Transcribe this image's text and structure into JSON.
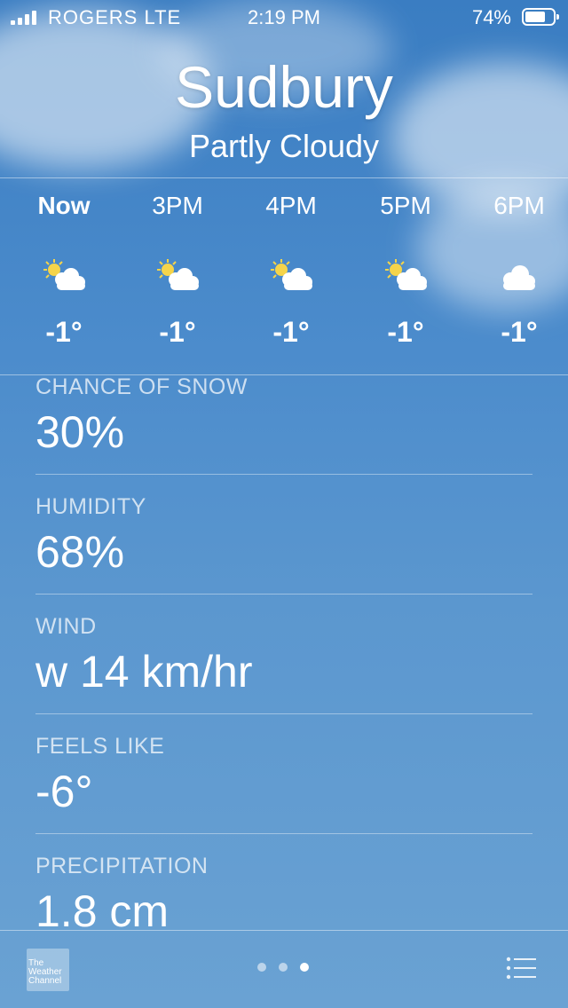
{
  "status_bar": {
    "carrier": "ROGERS LTE",
    "time": "2:19 PM",
    "battery": "74%",
    "battery_level": 0.74
  },
  "location": {
    "city": "Sudbury",
    "condition": "Partly Cloudy"
  },
  "hourly": [
    {
      "time": "Now",
      "icon": "partly-cloudy-day-icon",
      "temp": "-1°"
    },
    {
      "time": "3PM",
      "icon": "partly-cloudy-day-icon",
      "temp": "-1°"
    },
    {
      "time": "4PM",
      "icon": "partly-cloudy-day-icon",
      "temp": "-1°"
    },
    {
      "time": "5PM",
      "icon": "partly-cloudy-day-icon",
      "temp": "-1°"
    },
    {
      "time": "6PM",
      "icon": "cloud-icon",
      "temp": "-1°"
    }
  ],
  "details": [
    {
      "label": "CHANCE OF SNOW",
      "value": "30%"
    },
    {
      "label": "HUMIDITY",
      "value": "68%"
    },
    {
      "label": "WIND",
      "value": "w 14 km/hr"
    },
    {
      "label": "FEELS LIKE",
      "value": "-6°"
    },
    {
      "label": "PRECIPITATION",
      "value": "1.8 cm"
    }
  ],
  "footer": {
    "logo_text": "The Weather Channel",
    "page_count": 3,
    "active_page": 3
  },
  "colors": {
    "sun": "#f5d44a",
    "background_top": "#3a7dc2",
    "background_bottom": "#6aa2d3"
  }
}
